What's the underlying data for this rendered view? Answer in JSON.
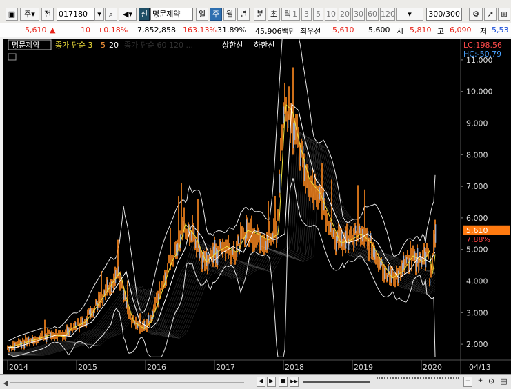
{
  "toolbar": {
    "market": "주",
    "prev_label": "전",
    "code": "017180",
    "credit_badge": "신",
    "stock_name": "명문제약",
    "periods": [
      "일",
      "주",
      "월",
      "년",
      "분",
      "초",
      "틱"
    ],
    "active_period": "주",
    "intervals": [
      "1",
      "3",
      "5",
      "10",
      "20",
      "30",
      "60",
      "120"
    ],
    "count": "300",
    "count_total": "/300"
  },
  "quote": {
    "price": "5,610",
    "change": "10",
    "change_pct": "+0.18%",
    "volume": "7,852,858",
    "vol_ratio": "163.13%",
    "turnover": "31.89%",
    "amount": "45,906백만",
    "best_label": "최우선",
    "best_ask": "5,610",
    "best_bid": "5,600",
    "open_label": "시",
    "open": "5,810",
    "high_label": "고",
    "high": "6,090",
    "low_label": "저",
    "low": "5,53"
  },
  "legend": {
    "name": "명문제약",
    "ma_label": "종가 단순",
    "ma_periods": [
      "3",
      "5",
      "20"
    ],
    "hidden_label": "종가 단순 60 120 ...",
    "upper_label": "상한선",
    "lower_label": "하한선",
    "lc": "LC:198.56",
    "hc": "HC:-50.79"
  },
  "chart_data": {
    "type": "line",
    "title": "",
    "x": [
      "2014",
      "2015",
      "2016",
      "2017",
      "2018",
      "2019",
      "2020"
    ],
    "x_end_label": "04/13",
    "y_ticks": [
      "11,000",
      "10,000",
      "9,000",
      "8,000",
      "7,000",
      "6,000",
      "5,000",
      "4,000",
      "3,000",
      "2,000"
    ],
    "ylim": [
      1500,
      11500
    ],
    "series": [
      {
        "name": "",
        "points": [
          [
            2014.0,
            1900
          ],
          [
            2014.3,
            2100
          ],
          [
            2014.6,
            2300
          ],
          [
            2014.8,
            2250
          ],
          [
            2014.9,
            2500
          ],
          [
            2015.1,
            2700
          ],
          [
            2015.3,
            3300
          ],
          [
            2015.45,
            3800
          ],
          [
            2015.6,
            4300
          ],
          [
            2015.7,
            3400
          ],
          [
            2015.8,
            2700
          ],
          [
            2015.95,
            2500
          ],
          [
            2016.05,
            2700
          ],
          [
            2016.2,
            3600
          ],
          [
            2016.35,
            4600
          ],
          [
            2016.45,
            5000
          ],
          [
            2016.55,
            5800
          ],
          [
            2016.7,
            5400
          ],
          [
            2016.85,
            4600
          ],
          [
            2017.0,
            4900
          ],
          [
            2017.15,
            5100
          ],
          [
            2017.3,
            4900
          ],
          [
            2017.45,
            5600
          ],
          [
            2017.6,
            5500
          ],
          [
            2017.75,
            5300
          ],
          [
            2017.9,
            5500
          ],
          [
            2018.0,
            9600
          ],
          [
            2018.1,
            9400
          ],
          [
            2018.2,
            8400
          ],
          [
            2018.35,
            7200
          ],
          [
            2018.5,
            6800
          ],
          [
            2018.65,
            6000
          ],
          [
            2018.8,
            5200
          ],
          [
            2018.95,
            5300
          ],
          [
            2019.1,
            5500
          ],
          [
            2019.25,
            5200
          ],
          [
            2019.4,
            4600
          ],
          [
            2019.55,
            4100
          ],
          [
            2019.7,
            4300
          ],
          [
            2019.85,
            4800
          ],
          [
            2020.0,
            4600
          ],
          [
            2020.1,
            5000
          ],
          [
            2020.12,
            4100
          ],
          [
            2020.16,
            4600
          ],
          [
            2020.2,
            5610
          ]
        ]
      }
    ],
    "current_label": "5,610",
    "current_pct": "7.88%",
    "colors": {
      "price": "#ff8a1e",
      "ma_short": "#7fb8ff",
      "ma_mid": "#f2e23c",
      "bands": "#e6e6e6",
      "current": "#ff7a10"
    }
  },
  "bottom": {
    "buttons": [
      "◀",
      "▶",
      "■",
      "▶▶"
    ],
    "zoom": [
      "−",
      "+"
    ],
    "icons": [
      "⊙",
      "▤"
    ]
  }
}
